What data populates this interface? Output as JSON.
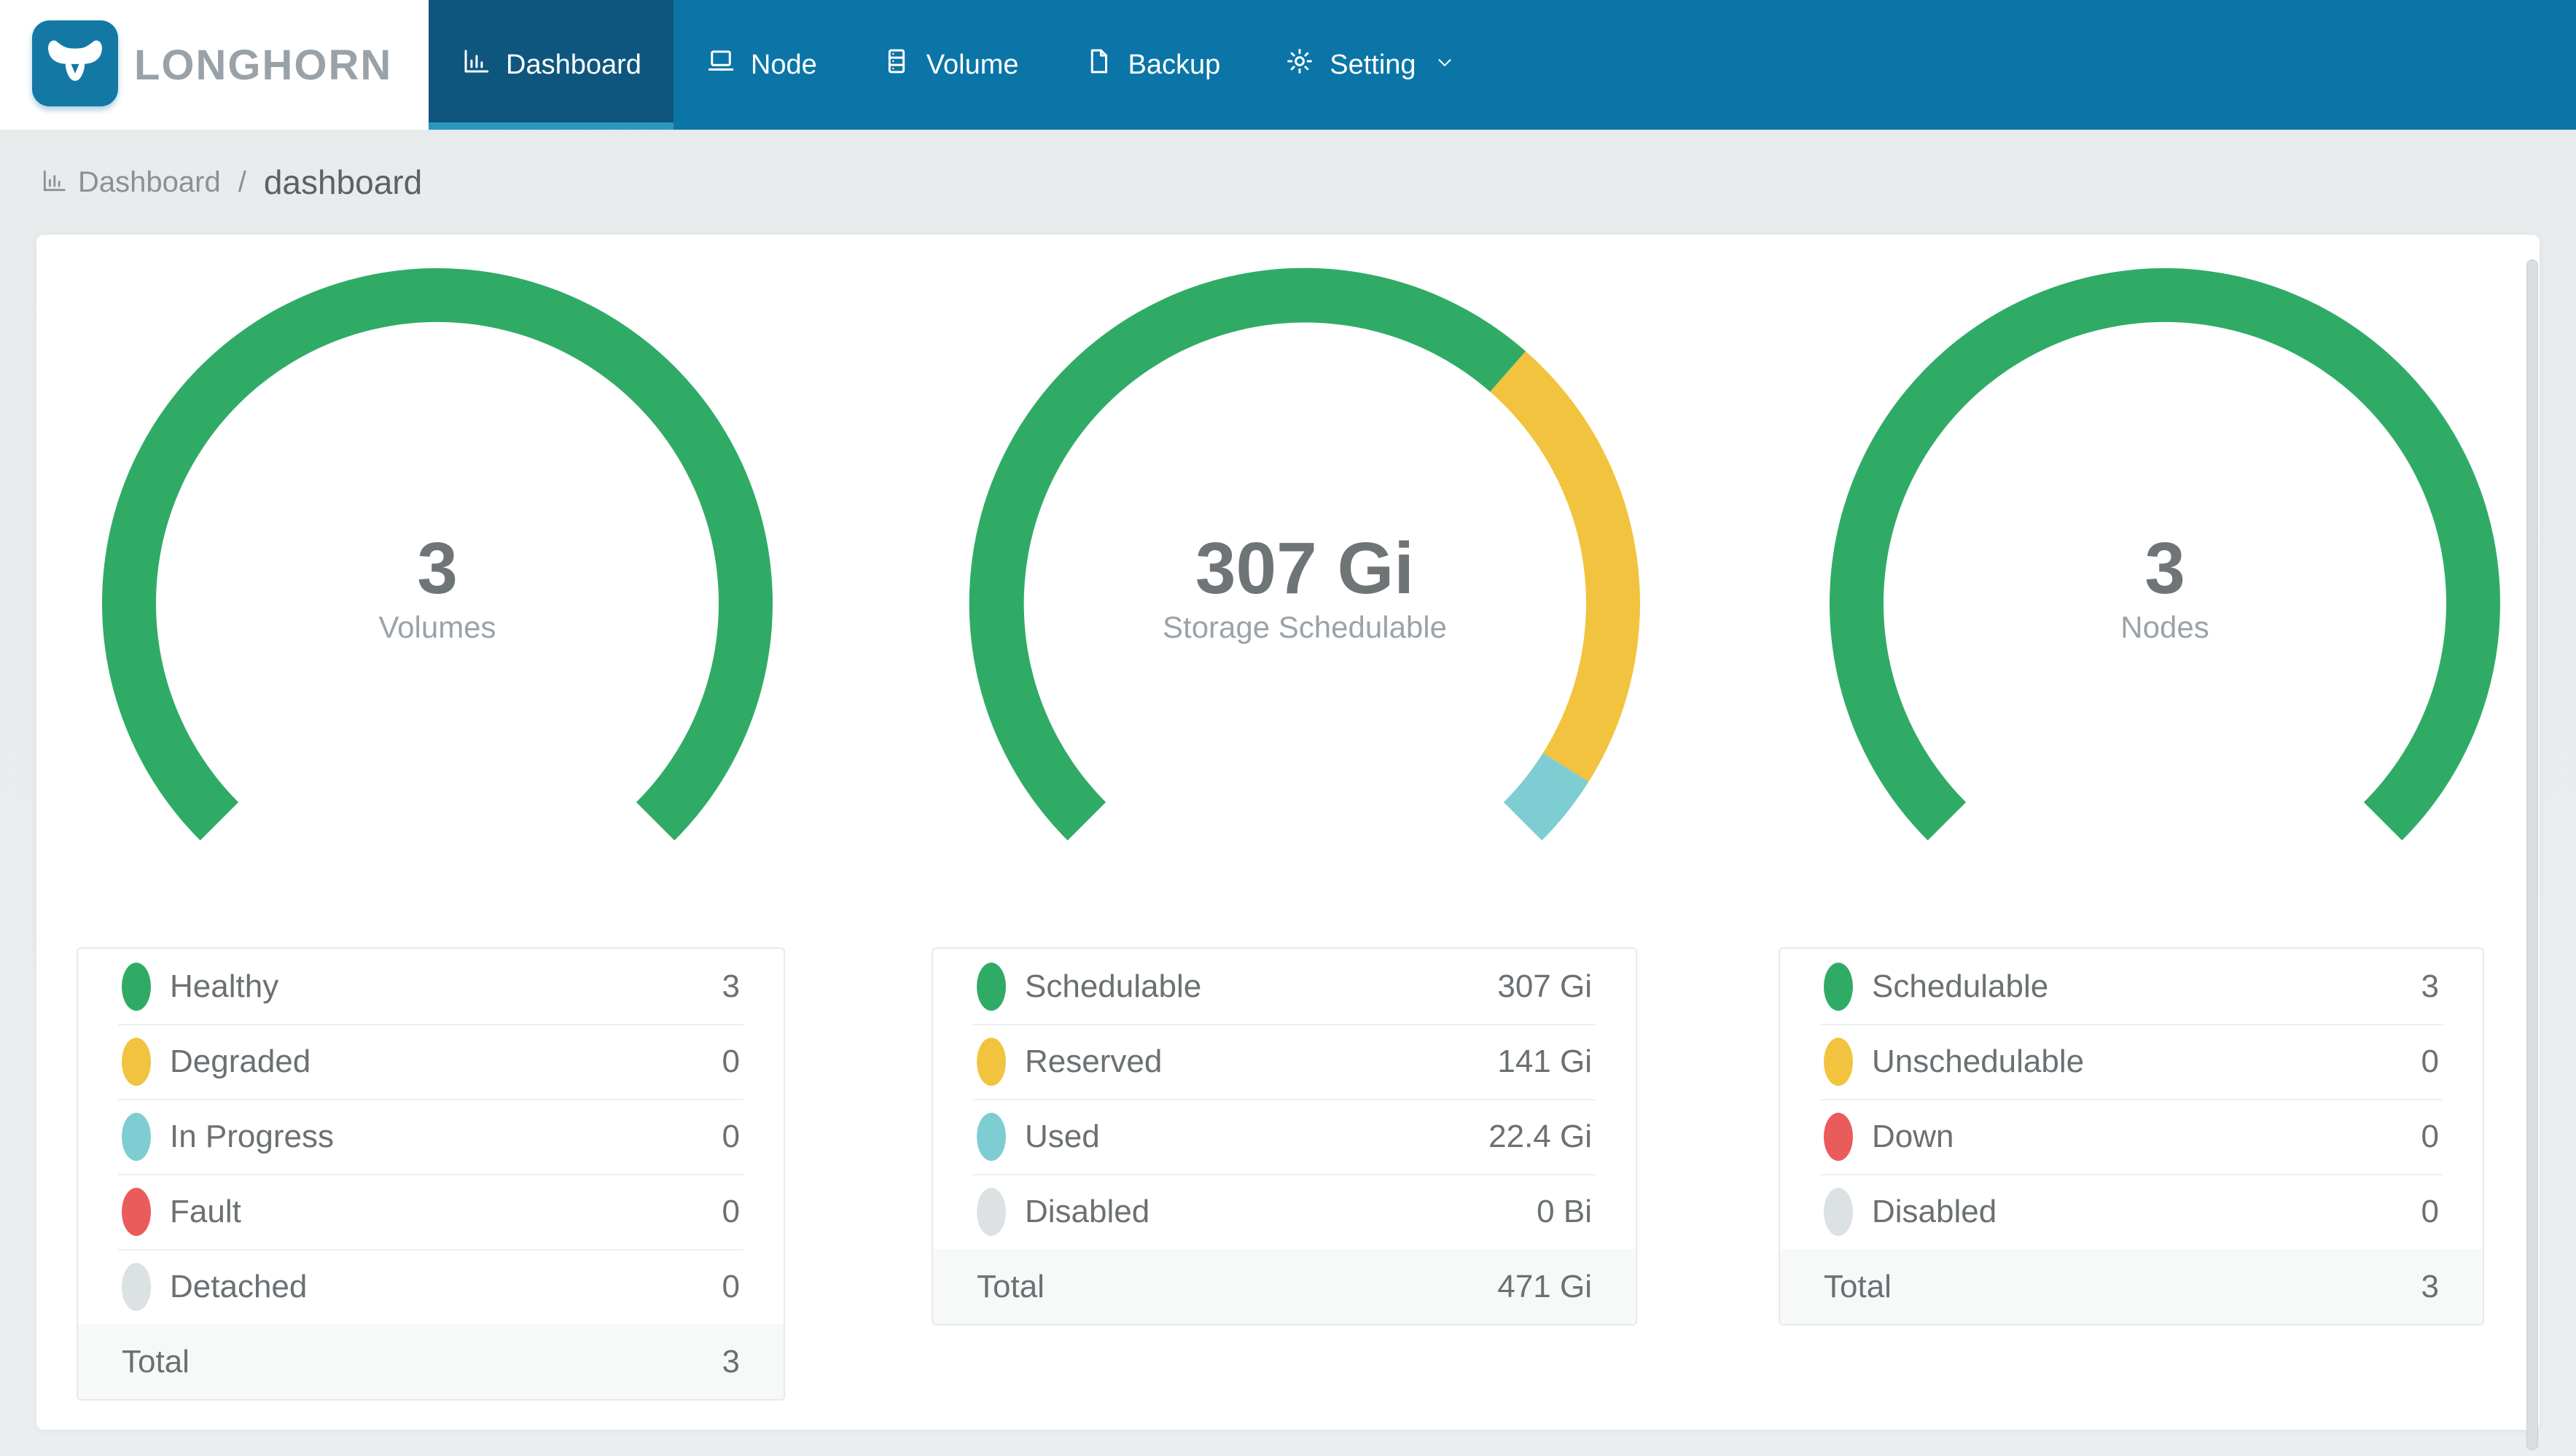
{
  "brand": {
    "name": "LONGHORN"
  },
  "nav": {
    "items": [
      {
        "label": "Dashboard",
        "active": true
      },
      {
        "label": "Node",
        "active": false
      },
      {
        "label": "Volume",
        "active": false
      },
      {
        "label": "Backup",
        "active": false
      },
      {
        "label": "Setting",
        "active": false,
        "has_dropdown": true
      }
    ]
  },
  "breadcrumb": {
    "section": "Dashboard",
    "separator": "/",
    "page": "dashboard"
  },
  "colors": {
    "nav_background": "#0b75a7",
    "nav_active_background": "#0f567f",
    "nav_active_underline": "#2b98c2",
    "healthy_green": "#30ab66",
    "warning_yellow": "#f2c33e",
    "progress_teal": "#7ecdd3",
    "fault_red": "#ea5b5c",
    "disabled_gray": "#dce1e4",
    "page_background": "#eaedef"
  },
  "chart_data": [
    {
      "type": "donut",
      "title": "Volumes",
      "center_value": "3",
      "center_label": "Volumes",
      "start_deg": 225,
      "sweep_deg": 270,
      "total": 3,
      "segments": [
        {
          "name": "Healthy",
          "value": 3,
          "color": "#30ab66"
        },
        {
          "name": "Degraded",
          "value": 0,
          "color": "#f2c33e"
        },
        {
          "name": "In Progress",
          "value": 0,
          "color": "#7ecdd3"
        },
        {
          "name": "Fault",
          "value": 0,
          "color": "#ea5b5c"
        },
        {
          "name": "Detached",
          "value": 0,
          "color": "#dce1e4"
        }
      ]
    },
    {
      "type": "donut",
      "title": "Storage Schedulable",
      "center_value": "307 Gi",
      "center_label": "Storage Schedulable",
      "start_deg": 225,
      "sweep_deg": 270,
      "total": 470.4,
      "total_display": "471 Gi",
      "segments": [
        {
          "name": "Schedulable",
          "value": 307,
          "color": "#30ab66"
        },
        {
          "name": "Reserved",
          "value": 141,
          "color": "#f2c33e"
        },
        {
          "name": "Used",
          "value": 22.4,
          "color": "#7ecdd3"
        },
        {
          "name": "Disabled",
          "value": 0,
          "color": "#dce1e4"
        }
      ]
    },
    {
      "type": "donut",
      "title": "Nodes",
      "center_value": "3",
      "center_label": "Nodes",
      "start_deg": 225,
      "sweep_deg": 270,
      "total": 3,
      "segments": [
        {
          "name": "Schedulable",
          "value": 3,
          "color": "#30ab66"
        },
        {
          "name": "Unschedulable",
          "value": 0,
          "color": "#f2c33e"
        },
        {
          "name": "Down",
          "value": 0,
          "color": "#ea5b5c"
        },
        {
          "name": "Disabled",
          "value": 0,
          "color": "#dce1e4"
        }
      ]
    }
  ],
  "legends": [
    {
      "rows": [
        {
          "label": "Healthy",
          "value": "3",
          "color": "#30ab66"
        },
        {
          "label": "Degraded",
          "value": "0",
          "color": "#f2c33e"
        },
        {
          "label": "In Progress",
          "value": "0",
          "color": "#7ecdd3"
        },
        {
          "label": "Fault",
          "value": "0",
          "color": "#ea5b5c"
        },
        {
          "label": "Detached",
          "value": "0",
          "color": "#dce1e4"
        }
      ],
      "total_label": "Total",
      "total_value": "3"
    },
    {
      "rows": [
        {
          "label": "Schedulable",
          "value": "307 Gi",
          "color": "#30ab66"
        },
        {
          "label": "Reserved",
          "value": "141 Gi",
          "color": "#f2c33e"
        },
        {
          "label": "Used",
          "value": "22.4 Gi",
          "color": "#7ecdd3"
        },
        {
          "label": "Disabled",
          "value": "0 Bi",
          "color": "#dce1e4"
        }
      ],
      "total_label": "Total",
      "total_value": "471 Gi"
    },
    {
      "rows": [
        {
          "label": "Schedulable",
          "value": "3",
          "color": "#30ab66"
        },
        {
          "label": "Unschedulable",
          "value": "0",
          "color": "#f2c33e"
        },
        {
          "label": "Down",
          "value": "0",
          "color": "#ea5b5c"
        },
        {
          "label": "Disabled",
          "value": "0",
          "color": "#dce1e4"
        }
      ],
      "total_label": "Total",
      "total_value": "3"
    }
  ]
}
